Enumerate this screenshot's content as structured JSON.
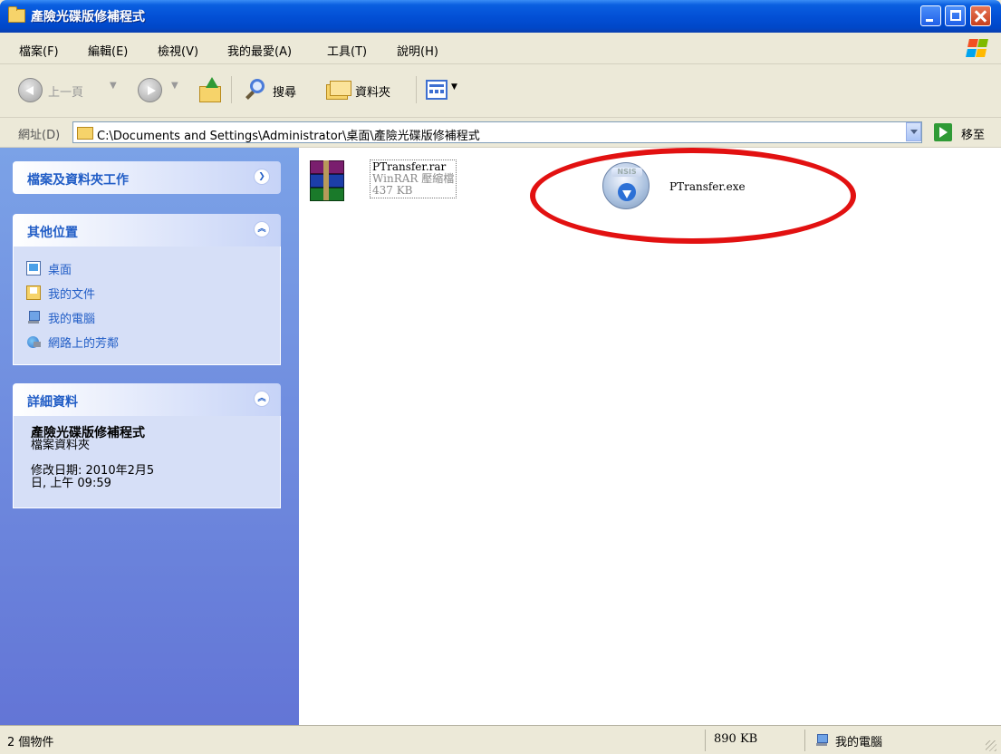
{
  "window": {
    "title": "產險光碟版修補程式"
  },
  "menu": {
    "items": [
      "檔案(F)",
      "編輯(E)",
      "檢視(V)",
      "我的最愛(A)",
      "工具(T)",
      "說明(H)"
    ]
  },
  "toolbar": {
    "back_label": "上一頁",
    "search_label": "搜尋",
    "folders_label": "資料夾"
  },
  "address": {
    "label": "網址(D)",
    "path": "C:\\Documents and Settings\\Administrator\\桌面\\產險光碟版修補程式",
    "go_label": "移至"
  },
  "sidebar": {
    "tasks_title": "檔案及資料夾工作",
    "other_title": "其他位置",
    "other_links": [
      {
        "label": "桌面",
        "icon": "desktop-icon"
      },
      {
        "label": "我的文件",
        "icon": "my-documents-icon"
      },
      {
        "label": "我的電腦",
        "icon": "my-computer-icon"
      },
      {
        "label": "網路上的芳鄰",
        "icon": "network-places-icon"
      }
    ],
    "details_title": "詳細資料",
    "details_name": "產險光碟版修補程式",
    "details_type": "檔案資料夾",
    "details_modified": "修改日期: 2010年2月5日, 上午 09:59"
  },
  "files": [
    {
      "name": "PTransfer.rar",
      "type": "WinRAR 壓縮檔",
      "size": "437 KB",
      "icon": "winrar-archive-icon"
    },
    {
      "name": "PTransfer.exe",
      "icon": "nsis-installer-icon",
      "badge": "NSIS"
    }
  ],
  "status": {
    "count": "2 個物件",
    "size": "890 KB",
    "location": "我的電腦"
  },
  "colors": {
    "annotation": "#e21111",
    "titlebar": "#0350d6",
    "sidebar": "#7ba2e7"
  }
}
